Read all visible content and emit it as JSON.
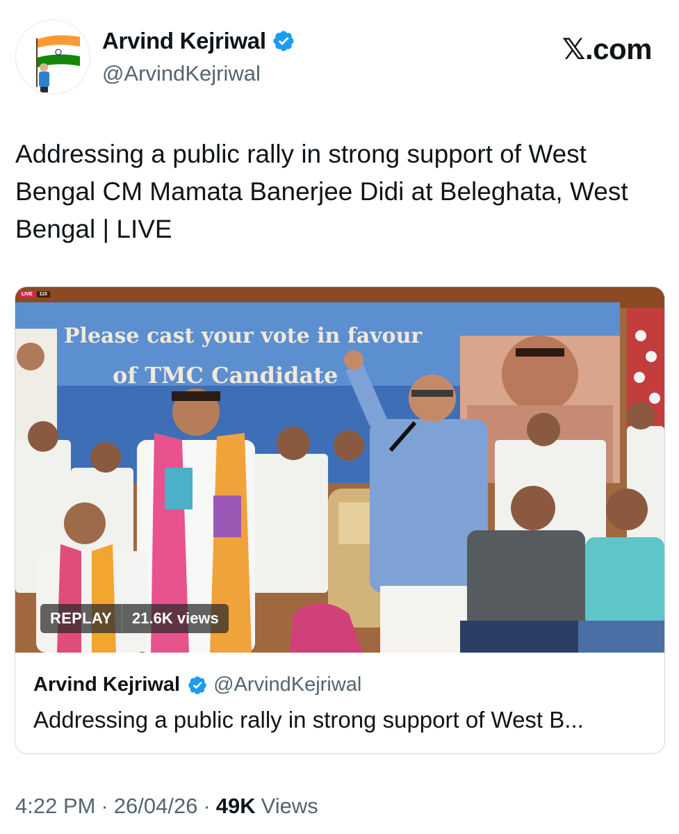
{
  "author": {
    "name": "Arvind Kejriwal",
    "handle": "@ArvindKejriwal",
    "verified": true
  },
  "brand": "𝕏.com",
  "tweet": {
    "text": "Addressing a public rally in strong support of West Bengal CM Mamata Banerjee Didi at Beleghata, West Bengal | LIVE"
  },
  "media": {
    "live_label": "LIVE",
    "live_viewers": "115",
    "replay_label": "REPLAY",
    "views_label": "21.6K views",
    "banner_line1": "Please cast your vote in favour",
    "banner_line2": "of TMC Candidate"
  },
  "quote": {
    "name": "Arvind Kejriwal",
    "handle": "@ArvindKejriwal",
    "text": "Addressing a public rally in strong support of West B..."
  },
  "footer": {
    "time": "4:22 PM",
    "date": "26/04/26",
    "views_count": "49K",
    "views_label": "Views"
  },
  "colors": {
    "verified_blue": "#1d9bf0",
    "text_primary": "#0f1419",
    "text_secondary": "#536471",
    "border": "#cfd9de"
  }
}
